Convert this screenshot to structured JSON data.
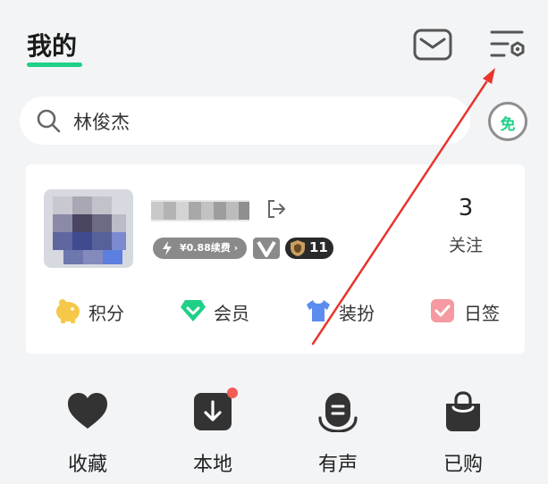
{
  "header": {
    "title": "我的"
  },
  "search": {
    "query": "林俊杰"
  },
  "free_badge": {
    "label": "免"
  },
  "profile": {
    "vip_text": "¥0.88续费 ›",
    "level": "11",
    "follow_count": "3",
    "follow_label": "关注"
  },
  "card_menu": [
    {
      "label": "积分",
      "icon": "piggy-bank-icon",
      "color": "#f6c84a"
    },
    {
      "label": "会员",
      "icon": "diamond-icon",
      "color": "#1fd087"
    },
    {
      "label": "装扮",
      "icon": "tshirt-icon",
      "color": "#5b8cf0"
    },
    {
      "label": "日签",
      "icon": "checkbox-icon",
      "color": "#f49aa0"
    }
  ],
  "quick_actions": [
    {
      "label": "收藏",
      "icon": "heart-icon"
    },
    {
      "label": "本地",
      "icon": "download-icon"
    },
    {
      "label": "有声",
      "icon": "audio-icon"
    },
    {
      "label": "已购",
      "icon": "shopping-bag-icon"
    }
  ],
  "colors": {
    "accent": "#1fd087",
    "annotation": "#e8352d"
  }
}
